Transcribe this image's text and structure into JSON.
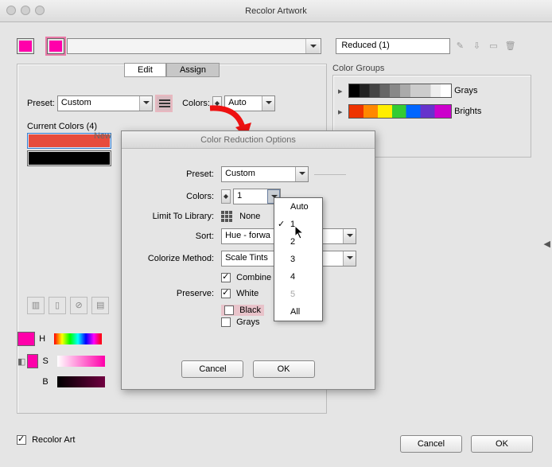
{
  "window": {
    "title": "Recolor Artwork"
  },
  "top": {
    "active_color": "#ff00aa",
    "group_name": "Reduced (1)"
  },
  "tabs": {
    "edit": "Edit",
    "assign": "Assign"
  },
  "preset": {
    "label": "Preset:",
    "value": "Custom"
  },
  "colors_top": {
    "label": "Colors:",
    "value": "Auto"
  },
  "current": {
    "label": "Current Colors (4)",
    "new_label": "New",
    "rows": [
      {
        "color": "#e74c3c",
        "selected": true
      },
      {
        "color": "#000000",
        "selected": false
      }
    ]
  },
  "hsb": {
    "h": "H",
    "s": "S",
    "b": "B",
    "swatch": "#ff00aa"
  },
  "colorgroups": {
    "label": "Color Groups",
    "groups": [
      {
        "name": "Grays",
        "type": "gray"
      },
      {
        "name": "Brights",
        "type": "bright"
      }
    ]
  },
  "subdialog": {
    "title": "Color Reduction Options",
    "preset": {
      "label": "Preset:",
      "value": "Custom"
    },
    "colors": {
      "label": "Colors:",
      "value": "1"
    },
    "limit": {
      "label": "Limit To Library:",
      "value": "None"
    },
    "sort": {
      "label": "Sort:",
      "value": "Hue - forwa"
    },
    "method": {
      "label": "Colorize Method:",
      "value": "Scale Tints"
    },
    "combine": {
      "label": "Combine T",
      "checked": true
    },
    "preserve": {
      "label": "Preserve:",
      "white": {
        "label": "White",
        "checked": true
      },
      "black": {
        "label": "Black",
        "checked": false
      },
      "grays": {
        "label": "Grays",
        "checked": false
      }
    },
    "buttons": {
      "cancel": "Cancel",
      "ok": "OK"
    }
  },
  "dropdown": {
    "items": [
      "Auto",
      "1",
      "2",
      "3",
      "4",
      "5",
      "All"
    ],
    "selected": "1",
    "disabled": [
      "5"
    ]
  },
  "bottom": {
    "recolor": {
      "label": "Recolor Art",
      "checked": true
    },
    "cancel": "Cancel",
    "ok": "OK"
  }
}
